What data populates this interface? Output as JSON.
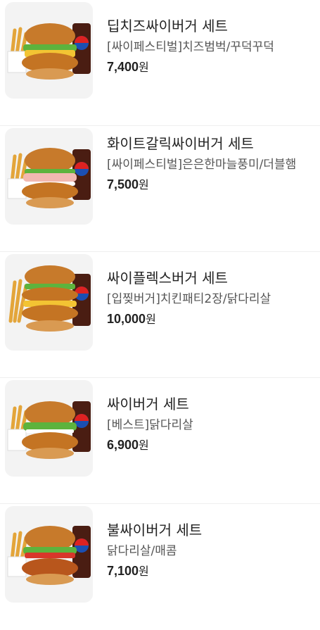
{
  "menu_items": [
    {
      "name": "딥치즈싸이버거 세트",
      "description": "[싸이페스티벌]치즈범벅/꾸덕꾸덕",
      "price": "7,400",
      "currency": "원"
    },
    {
      "name": "화이트갈릭싸이버거 세트",
      "description": "[싸이페스티벌]은은한마늘풍미/더블햄",
      "price": "7,500",
      "currency": "원"
    },
    {
      "name": "싸이플렉스버거 세트",
      "description": "[입찢버거]치킨패티2장/닭다리살",
      "price": "10,000",
      "currency": "원"
    },
    {
      "name": "싸이버거 세트",
      "description": "[베스트]닭다리살",
      "price": "6,900",
      "currency": "원"
    },
    {
      "name": "불싸이버거 세트",
      "description": "닭다리살/매콤",
      "price": "7,100",
      "currency": "원"
    }
  ]
}
